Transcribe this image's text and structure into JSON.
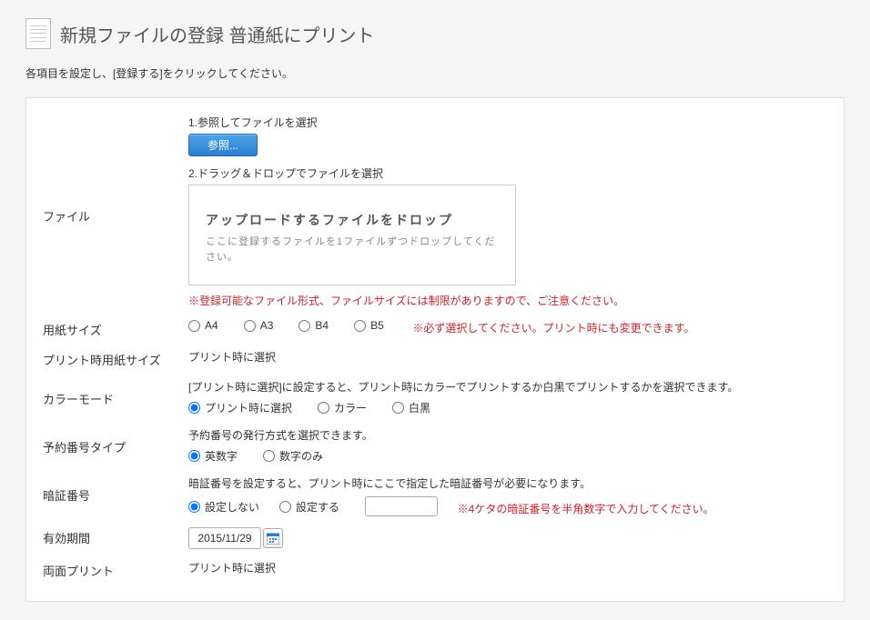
{
  "header": {
    "title": "新規ファイルの登録  普通紙にプリント",
    "instruction": "各項目を設定し、[登録する]をクリックしてください。"
  },
  "file_section": {
    "label": "ファイル",
    "method1_label": "1.参照してファイルを選択",
    "browse_button": "参照...",
    "method2_label": "2.ドラッグ＆ドロップでファイルを選択",
    "drop_title": "アップロードするファイルをドロップ",
    "drop_sub": "ここに登録するファイルを1ファイルずつドロップしてください。",
    "note": "※登録可能なファイル形式、ファイルサイズには制限がありますので、ご注意ください。"
  },
  "paper_size": {
    "label": "用紙サイズ",
    "options": {
      "a4": "A4",
      "a3": "A3",
      "b4": "B4",
      "b5": "B5"
    },
    "note": "※必ず選択してください。プリント時にも変更できます。"
  },
  "print_paper_size": {
    "label": "プリント時用紙サイズ",
    "value": "プリント時に選択"
  },
  "color_mode": {
    "label": "カラーモード",
    "hint": "[プリント時に選択]に設定すると、プリント時にカラーでプリントするか白黒でプリントするかを選択できます。",
    "options": {
      "at_print": "プリント時に選択",
      "color": "カラー",
      "bw": "白黒"
    }
  },
  "reservation_type": {
    "label": "予約番号タイプ",
    "hint": "予約番号の発行方式を選択できます。",
    "options": {
      "alnum": "英数字",
      "numeric": "数字のみ"
    }
  },
  "pin": {
    "label": "暗証番号",
    "hint": "暗証番号を設定すると、プリント時にここで指定した暗証番号が必要になります。",
    "options": {
      "no": "設定しない",
      "yes": "設定する"
    },
    "input_value": "",
    "note": "※4ケタの暗証番号を半角数字で入力してください。"
  },
  "expiry": {
    "label": "有効期間",
    "value": "2015/11/29"
  },
  "duplex": {
    "label": "両面プリント",
    "value": "プリント時に選択"
  }
}
